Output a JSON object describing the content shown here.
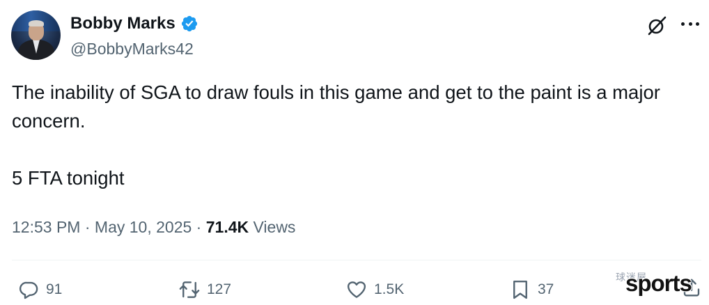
{
  "author": {
    "display_name": "Bobby Marks",
    "handle": "@BobbyMarks42",
    "verified": true,
    "verified_color": "#1d9bf0"
  },
  "tweet": {
    "paragraphs": [
      "The inability of SGA to draw fouls in this game and get to the paint is a major concern.",
      "5 FTA tonight"
    ]
  },
  "meta": {
    "time": "12:53 PM",
    "separator": "·",
    "date": "May 10, 2025",
    "views_count": "71.4K",
    "views_label": "Views"
  },
  "actions": {
    "replies": "91",
    "reposts": "127",
    "likes": "1.5K",
    "bookmarks": "37"
  },
  "icons": {
    "grok": "grok-icon",
    "more": "more-icon",
    "reply": "reply-icon",
    "repost": "repost-icon",
    "like": "heart-icon",
    "bookmark": "bookmark-icon",
    "share": "share-icon"
  },
  "watermark": {
    "text": "sports",
    "overlay": "球迷屋"
  },
  "colors": {
    "text_primary": "#0f1419",
    "text_secondary": "#536471",
    "divider": "#eff3f4"
  }
}
